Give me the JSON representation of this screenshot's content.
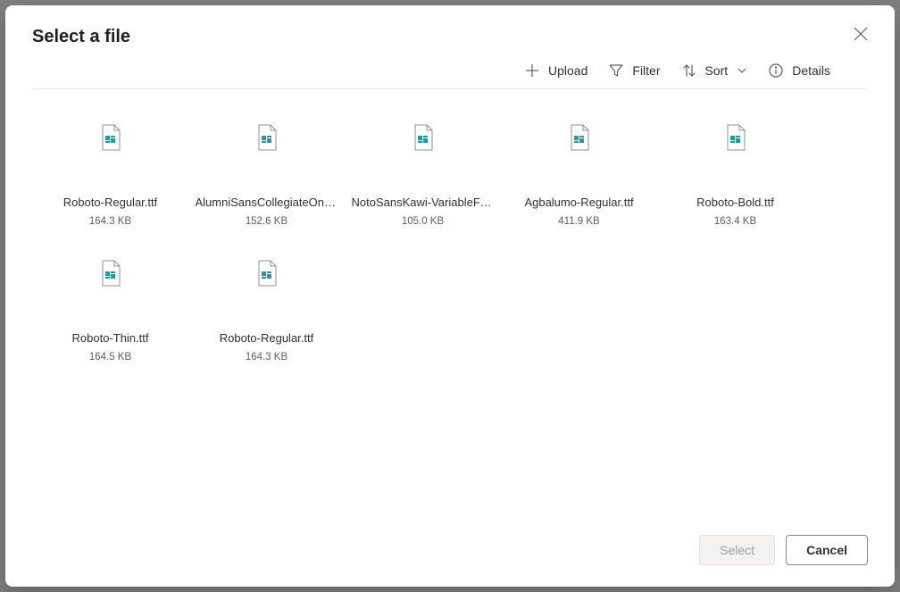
{
  "header": {
    "title": "Select a file"
  },
  "toolbar": {
    "upload": "Upload",
    "filter": "Filter",
    "sort": "Sort",
    "details": "Details"
  },
  "files": [
    {
      "name": "Roboto-Regular.ttf",
      "size": "164.3 KB"
    },
    {
      "name": "AlumniSansCollegiateOne-Regular.ttf",
      "size": "152.6 KB"
    },
    {
      "name": "NotoSansKawi-VariableFont_wght.ttf",
      "size": "105.0 KB"
    },
    {
      "name": "Agbalumo-Regular.ttf",
      "size": "411.9 KB"
    },
    {
      "name": "Roboto-Bold.ttf",
      "size": "163.4 KB"
    },
    {
      "name": "Roboto-Thin.ttf",
      "size": "164.5 KB"
    },
    {
      "name": "Roboto-Regular.ttf",
      "size": "164.3 KB"
    }
  ],
  "footer": {
    "select": "Select",
    "cancel": "Cancel"
  }
}
